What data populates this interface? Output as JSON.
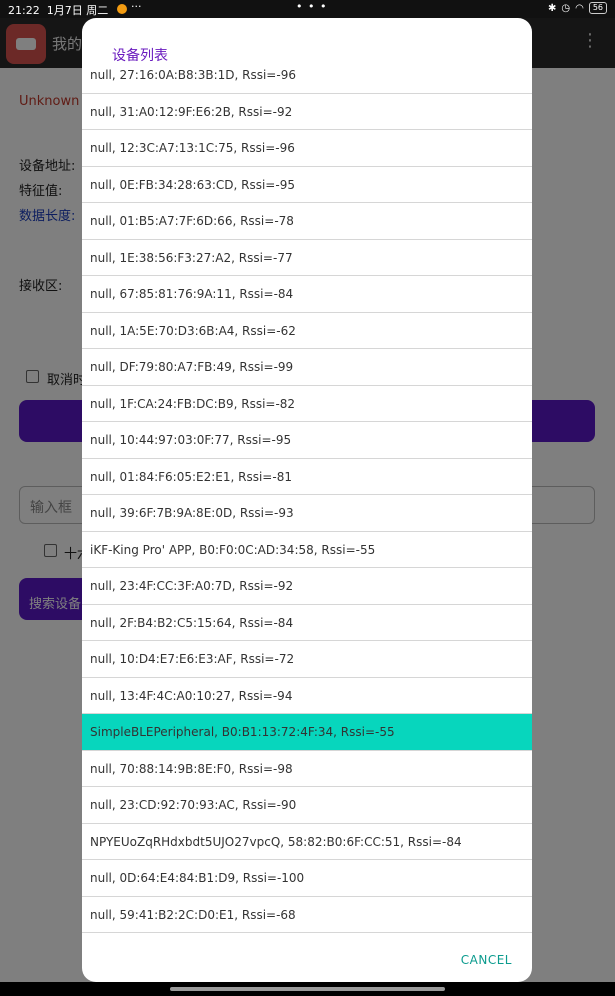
{
  "status_bar": {
    "time": "21:22",
    "date": "1月7日 周二",
    "extra": "···",
    "center": "• • •",
    "right_icons": [
      "bluetooth-icon",
      "alarm-icon",
      "wifi-icon"
    ],
    "battery": "56"
  },
  "app": {
    "title": "我的",
    "unknown_label": "Unknown",
    "device_address_label": "设备地址:",
    "characteristic_label": "特征值:",
    "data_length_label": "数据长度:",
    "receive_label": "接收区:",
    "cancel_checkbox_label": "取消时",
    "input_placeholder": "输入框",
    "hex_checkbox_label": "十六",
    "search_button_label": "搜索设备"
  },
  "dialog": {
    "title": "设备列表",
    "cancel_label": "CANCEL",
    "selected_index": 18,
    "items": [
      "null, 27:16:0A:B8:3B:1D, Rssi=-96",
      "null, 31:A0:12:9F:E6:2B, Rssi=-92",
      "null, 12:3C:A7:13:1C:75, Rssi=-96",
      "null, 0E:FB:34:28:63:CD, Rssi=-95",
      "null, 01:B5:A7:7F:6D:66, Rssi=-78",
      "null, 1E:38:56:F3:27:A2, Rssi=-77",
      "null, 67:85:81:76:9A:11, Rssi=-84",
      "null, 1A:5E:70:D3:6B:A4, Rssi=-62",
      "null, DF:79:80:A7:FB:49, Rssi=-99",
      "null, 1F:CA:24:FB:DC:B9, Rssi=-82",
      "null, 10:44:97:03:0F:77, Rssi=-95",
      "null, 01:84:F6:05:E2:E1, Rssi=-81",
      "null, 39:6F:7B:9A:8E:0D, Rssi=-93",
      "iKF-King Pro' APP, B0:F0:0C:AD:34:58, Rssi=-55",
      "null, 23:4F:CC:3F:A0:7D, Rssi=-92",
      "null, 2F:B4:B2:C5:15:64, Rssi=-84",
      "null, 10:D4:E7:E6:E3:AF, Rssi=-72",
      "null, 13:4F:4C:A0:10:27, Rssi=-94",
      "SimpleBLEPeripheral, B0:B1:13:72:4F:34, Rssi=-55",
      "null, 70:88:14:9B:8E:F0, Rssi=-98",
      "null, 23:CD:92:70:93:AC, Rssi=-90",
      "NPYEUoZqRHdxbdt5UJO27vpcQ, 58:82:B0:6F:CC:51, Rssi=-84",
      "null, 0D:64:E4:84:B1:D9, Rssi=-100",
      "null, 59:41:B2:2C:D0:E1, Rssi=-68"
    ]
  },
  "colors": {
    "accent": "#5a18c9",
    "selected_row": "#07d6bd",
    "dialog_title": "#6a1bbf",
    "cancel": "#0b9b8e"
  }
}
